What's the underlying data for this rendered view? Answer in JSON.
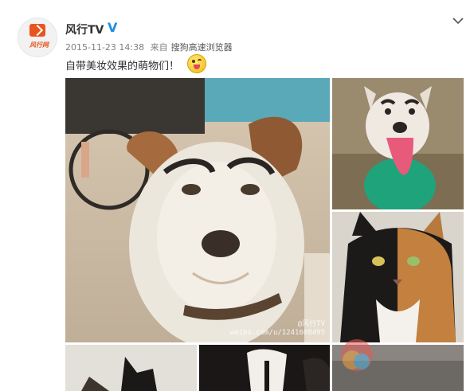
{
  "post": {
    "author": "风行TV",
    "verified_mark": "V",
    "timestamp": "2015-11-23 14:38",
    "source_prefix": "来自",
    "source": "搜狗高速浏览器",
    "text": "自带美妆效果的萌物们！",
    "emoji_name": "tongue-out-emoji"
  },
  "avatar": {
    "logo_text": "风行网"
  },
  "images": {
    "main_watermark_line1": "@风行TV",
    "main_watermark_line2": "weibo.com/u/1241608495"
  },
  "icons": {
    "menu": "chevron-down-icon"
  },
  "colors": {
    "brand_orange": "#e8541e",
    "verified_blue": "#1e8fe1"
  }
}
